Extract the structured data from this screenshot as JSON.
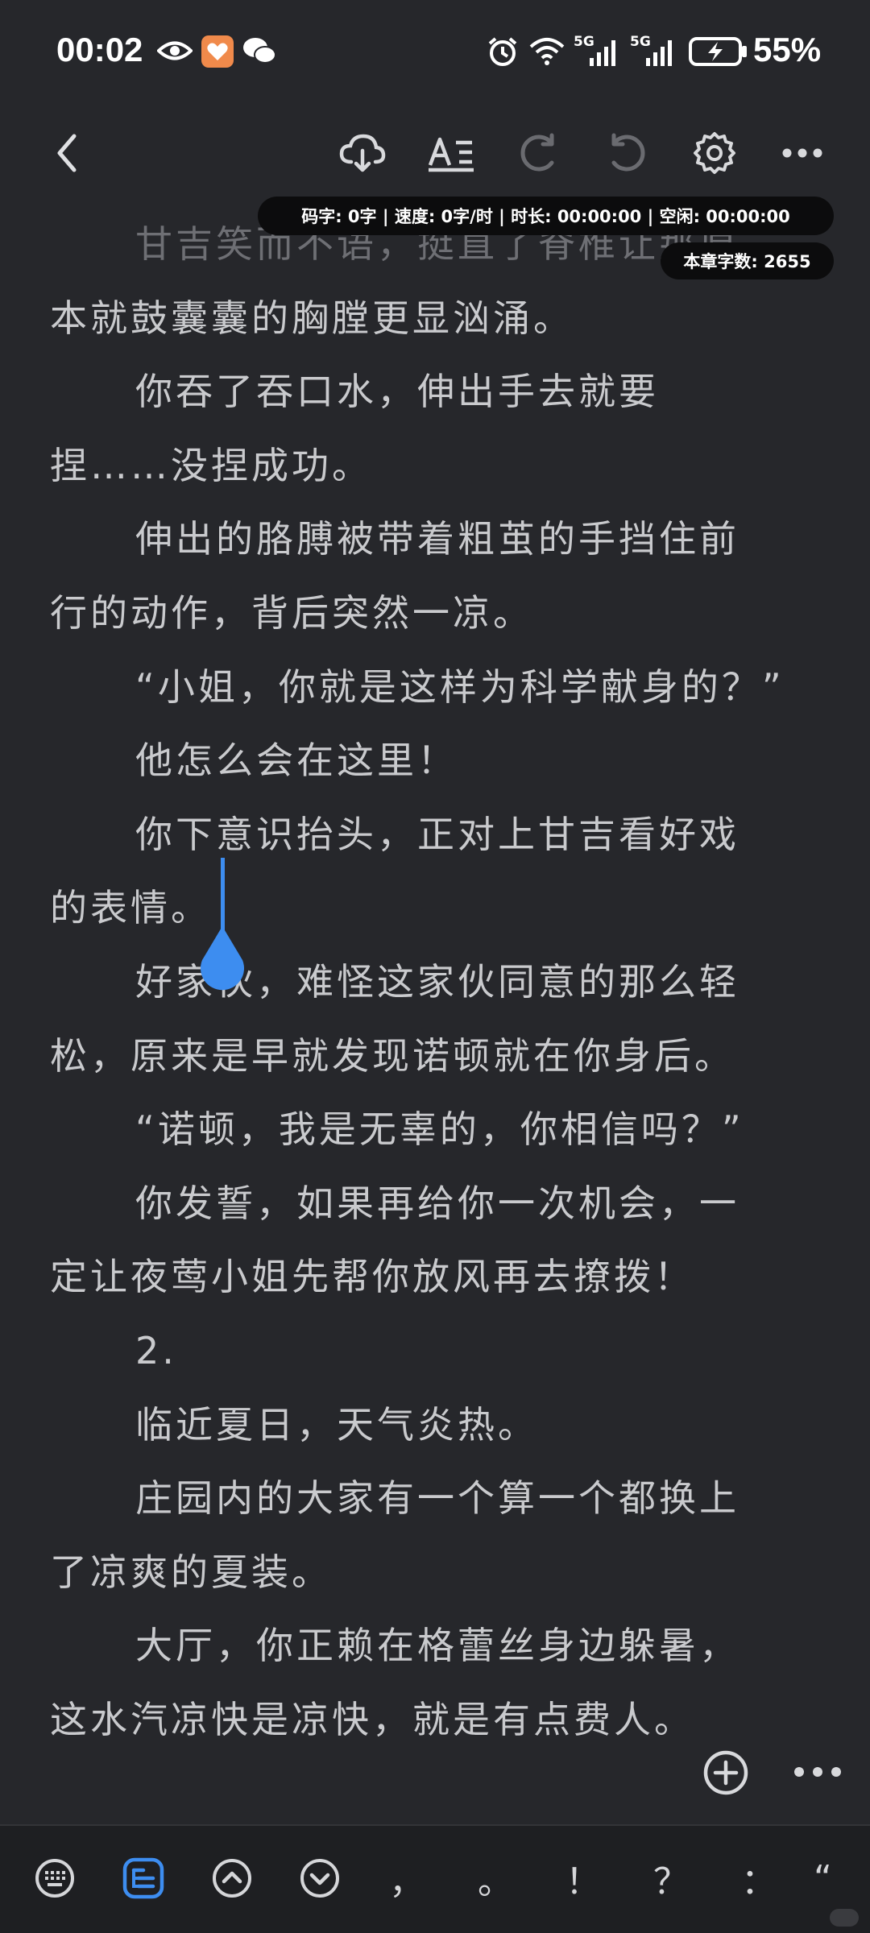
{
  "status_bar": {
    "time": "00:02",
    "battery": "55%",
    "signal_1": "5G",
    "signal_2": "5G"
  },
  "toolbar": {
    "back_icon": "chevron-left-icon",
    "cloud_icon": "cloud-sync-icon",
    "font_icon": "text-format-icon",
    "undo_icon": "undo-icon",
    "redo_icon": "redo-icon",
    "settings_icon": "gear-icon",
    "more_icon": "more-horizontal-icon"
  },
  "stats": {
    "line": "码字: 0字 | 速度: 0字/时 | 时长: 00:00:00 | 空闲: 00:00:00",
    "chapter_words": "本章字数: 2655"
  },
  "editor": {
    "lines": [
      {
        "text": "甘吉笑而不语，挺直了脊椎让那原",
        "indent": true,
        "faded": true
      },
      {
        "text": "本就鼓囊囊的胸膛更显汹涌。",
        "indent": false
      },
      {
        "text": "你吞了吞口水，伸出手去就要",
        "indent": true
      },
      {
        "text": "捏……没捏成功。",
        "indent": false
      },
      {
        "text": "伸出的胳膊被带着粗茧的手挡住前",
        "indent": true
      },
      {
        "text": "行的动作，背后突然一凉。",
        "indent": false
      },
      {
        "text": "“小姐，你就是这样为科学献身的？”",
        "indent": true
      },
      {
        "text": "他怎么会在这里！",
        "indent": true
      },
      {
        "text": "你下意识抬头，正对上甘吉看好戏",
        "indent": true
      },
      {
        "text": "的表情。",
        "indent": false
      },
      {
        "text": "好家伙，难怪这家伙同意的那么轻",
        "indent": true
      },
      {
        "text": "松，原来是早就发现诺顿就在你身后。",
        "indent": false
      },
      {
        "text": "“诺顿，我是无辜的，你相信吗？”",
        "indent": true
      },
      {
        "text": "你发誓，如果再给你一次机会，一",
        "indent": true
      },
      {
        "text": "定让夜莺小姐先帮你放风再去撩拨！",
        "indent": false
      },
      {
        "text": "2.",
        "indent": true
      },
      {
        "text": "临近夏日，天气炎热。",
        "indent": true
      },
      {
        "text": "庄园内的大家有一个算一个都换上",
        "indent": true
      },
      {
        "text": "了凉爽的夏装。",
        "indent": false
      },
      {
        "text": "大厅，你正赖在格蕾丝身边躲暑，",
        "indent": true
      },
      {
        "text": "这水汽凉快是凉快，就是有点费人。",
        "indent": false
      }
    ]
  },
  "keyboard_bar": {
    "keyboard_icon": "keyboard-icon",
    "outline_icon": "outline-icon",
    "up_icon": "chevron-up-icon",
    "down_icon": "chevron-down-icon",
    "comma": "，",
    "period": "。",
    "exclaim": "！",
    "question": "？",
    "colon": "：",
    "quote": "“"
  },
  "colors": {
    "background": "#26272b",
    "text": "#c9cacd",
    "accent": "#3d8df0"
  }
}
